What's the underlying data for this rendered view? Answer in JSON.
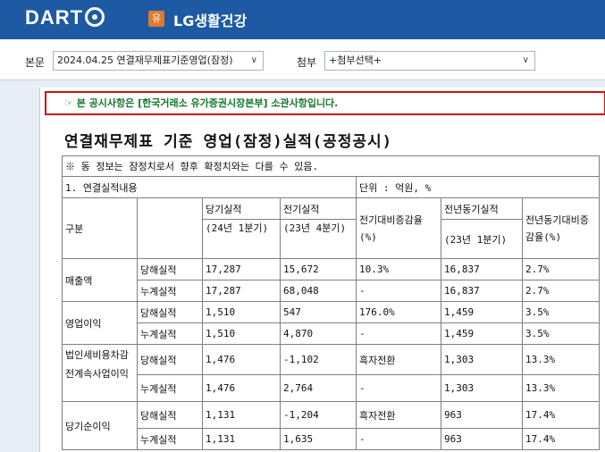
{
  "header": {
    "logo": "DART",
    "badge": "유",
    "company": "LG생활건강"
  },
  "toolbar": {
    "main_label": "본문",
    "main_select": "2024.04.25  연결재무제표기준영업(잠정)",
    "attach_label": "첨부",
    "attach_select": "+첨부선택+"
  },
  "notice": "☞ 본 공시사항은 [한국거래소 유가증권시장본부] 소관사항입니다.",
  "title": "연결재무제표 기준 영업(잠정)실적(공정공시)",
  "table": {
    "note": "※ 동 정보는 잠정치로서 향후 확정치와는 다를 수 있음.",
    "section": "1. 연결실적내용",
    "unit": "단위 : 억원, %",
    "headers": {
      "category": "구분",
      "current": "당기실적",
      "current_period": "(24년 1분기)",
      "previous": "전기실적",
      "previous_period": "(23년 4분기)",
      "qoq": "전기대비증감율(%)",
      "yoy_prev": "전년동기실적",
      "yoy_prev_period": "(23년 1분기)",
      "yoy": "전년동기대비증감율(%)"
    },
    "rows": [
      {
        "item": "매출액",
        "type": "당해실적",
        "cur": "17,287",
        "prev": "15,672",
        "qoq": "10.3%",
        "yprev": "16,837",
        "yoy": "2.7%"
      },
      {
        "item": "",
        "type": "누계실적",
        "cur": "17,287",
        "prev": "68,048",
        "qoq": "-",
        "yprev": "16,837",
        "yoy": "2.7%"
      },
      {
        "item": "영업이익",
        "type": "당해실적",
        "cur": "1,510",
        "prev": "547",
        "qoq": "176.0%",
        "yprev": "1,459",
        "yoy": "3.5%"
      },
      {
        "item": "",
        "type": "누계실적",
        "cur": "1,510",
        "prev": "4,870",
        "qoq": "-",
        "yprev": "1,459",
        "yoy": "3.5%"
      },
      {
        "item": "법인세비용차감전계속사업이익",
        "type": "당해실적",
        "cur": "1,476",
        "prev": "-1,102",
        "qoq": "흑자전환",
        "yprev": "1,303",
        "yoy": "13.3%"
      },
      {
        "item": "",
        "type": "누계실적",
        "cur": "1,476",
        "prev": "2,764",
        "qoq": "-",
        "yprev": "1,303",
        "yoy": "13.3%"
      },
      {
        "item": "당기순이익",
        "type": "당해실적",
        "cur": "1,131",
        "prev": "-1,204",
        "qoq": "흑자전환",
        "yprev": "963",
        "yoy": "17.4%"
      },
      {
        "item": "",
        "type": "누계실적",
        "cur": "1,131",
        "prev": "1,635",
        "qoq": "-",
        "yprev": "963",
        "yoy": "17.4%"
      }
    ]
  },
  "colors": {
    "header_bg": "#1d5aa3",
    "notice_border": "#cc1111",
    "notice_text": "#127a2a"
  }
}
